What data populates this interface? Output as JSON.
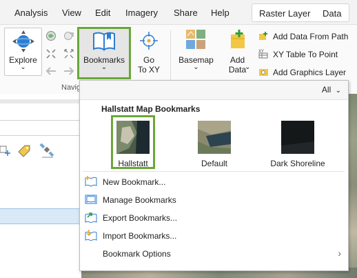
{
  "menubar": {
    "items": [
      "Analysis",
      "View",
      "Edit",
      "Imagery",
      "Share",
      "Help"
    ],
    "contextual_tabs": [
      "Raster Layer",
      "Data"
    ]
  },
  "ribbon": {
    "explore_label": "Explore",
    "bookmarks_label": "Bookmarks",
    "goto_label_line1": "Go",
    "goto_label_line2": "To XY",
    "basemap_label": "Basemap",
    "adddata_label_line1": "Add",
    "adddata_label_line2": "Data",
    "navigate_group_label": "Navig",
    "small_actions": [
      "Add Data From Path",
      "XY Table To Point",
      "Add Graphics Layer"
    ]
  },
  "bookmarks_panel": {
    "filter_label": "All",
    "title": "Hallstatt Map Bookmarks",
    "bookmarks": [
      {
        "name": "Hallstatt",
        "selected": true
      },
      {
        "name": "Default",
        "selected": false
      },
      {
        "name": "Dark Shoreline",
        "selected": false
      }
    ],
    "menu_items": [
      {
        "label": "New Bookmark...",
        "icon": "new-bookmark-icon"
      },
      {
        "label": "Manage Bookmarks",
        "icon": "manage-bookmarks-icon"
      },
      {
        "label": "Export Bookmarks...",
        "icon": "export-bookmarks-icon"
      },
      {
        "label": "Import Bookmarks...",
        "icon": "import-bookmarks-icon"
      },
      {
        "label": "Bookmark Options",
        "icon": "",
        "has_submenu": true
      }
    ]
  },
  "colors": {
    "selection_green": "#6aa639",
    "accent_blue": "#2b7cd3"
  }
}
